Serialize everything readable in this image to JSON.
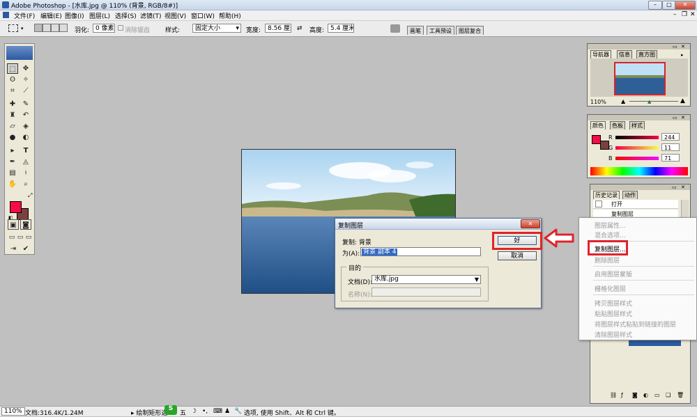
{
  "window": {
    "title": "Adobe Photoshop - [水库.jpg @ 110% (背景, RGB/8#)]"
  },
  "menu": [
    "文件(F)",
    "编辑(E)",
    "图像(I)",
    "图层(L)",
    "选择(S)",
    "滤镜(T)",
    "视图(V)",
    "窗口(W)",
    "帮助(H)"
  ],
  "options": {
    "feather_label": "羽化:",
    "feather_value": "0 像素",
    "antialias_label": "消除锯齿",
    "style_label": "样式:",
    "style_value": "固定大小",
    "width_label": "宽度:",
    "width_value": "8.56 厘米",
    "height_label": "高度:",
    "height_value": "5.4 厘米",
    "tabs": [
      "画笔",
      "工具预设",
      "图层复合"
    ]
  },
  "navigator": {
    "tabs": [
      "导航器",
      "信息",
      "直方图"
    ],
    "zoom": "110%"
  },
  "color_panel": {
    "tabs": [
      "颜色",
      "色板",
      "样式"
    ],
    "r_label": "R",
    "r_value": "244",
    "g_label": "G",
    "g_value": "11",
    "b_label": "B",
    "b_value": "71",
    "fg_color": "#f40b47",
    "bg_color": "#7a4040"
  },
  "history_panel": {
    "tabs": [
      "历史记录",
      "动作"
    ],
    "items": [
      "打开",
      "复制图层"
    ]
  },
  "dialog": {
    "title": "复制图层",
    "copy_label": "复制: 背景",
    "as_label": "为(A):",
    "as_value": "背景 副本 4",
    "ok_label": "好",
    "cancel_label": "取消",
    "dest_group": "目的",
    "doc_label": "文档(D):",
    "doc_value": "水库.jpg",
    "name_label": "名称(N):"
  },
  "context_menu": {
    "items": [
      {
        "label": "图层属性...",
        "enabled": false
      },
      {
        "label": "混合选项...",
        "enabled": false
      },
      {
        "label": "复制图层...",
        "enabled": true
      },
      {
        "label": "删除图层",
        "enabled": false
      },
      {
        "label": "启用图层蒙版",
        "enabled": false
      },
      {
        "label": "栅格化图层",
        "enabled": false
      },
      {
        "label": "拷贝图层样式",
        "enabled": false
      },
      {
        "label": "粘贴图层样式",
        "enabled": false
      },
      {
        "label": "将图层样式粘贴到链接的图层",
        "enabled": false
      },
      {
        "label": "清除图层样式",
        "enabled": false
      }
    ]
  },
  "status": {
    "zoom": "110%",
    "doc_size": "文档:316.4K/1.24M",
    "hint": "▸ 绘制矩形选",
    "ime": "五",
    "hint_tail": "选项, 使用 Shift、Alt 和 Ctrl 键。"
  },
  "colors": {
    "accent_red": "#e0232c",
    "ps_blue": "#2c5aa0"
  }
}
